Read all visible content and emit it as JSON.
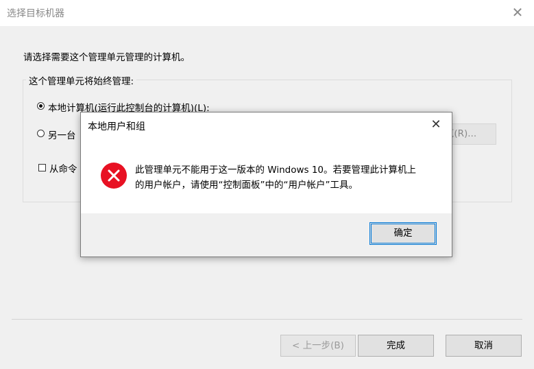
{
  "window": {
    "title": "选择目标机器"
  },
  "main": {
    "prompt": "请选择需要这个管理单元管理的计算机。",
    "group_legend": "这个管理单元将始终管理:",
    "radio_local": "本地计算机(运行此控制台的计算机)(L):",
    "radio_other": "另一台",
    "browse": "览(R)...",
    "checkbox_label": "从命令"
  },
  "footer": {
    "back": "< 上一步(B)",
    "finish": "完成",
    "cancel": "取消"
  },
  "dialog": {
    "title": "本地用户和组",
    "message_line1": "此管理单元不能用于这一版本的 Windows 10。若要管理此计算机上",
    "message_line2": "的用户帐户，请使用“控制面板”中的“用户帐户”工具。",
    "ok": "确定"
  }
}
